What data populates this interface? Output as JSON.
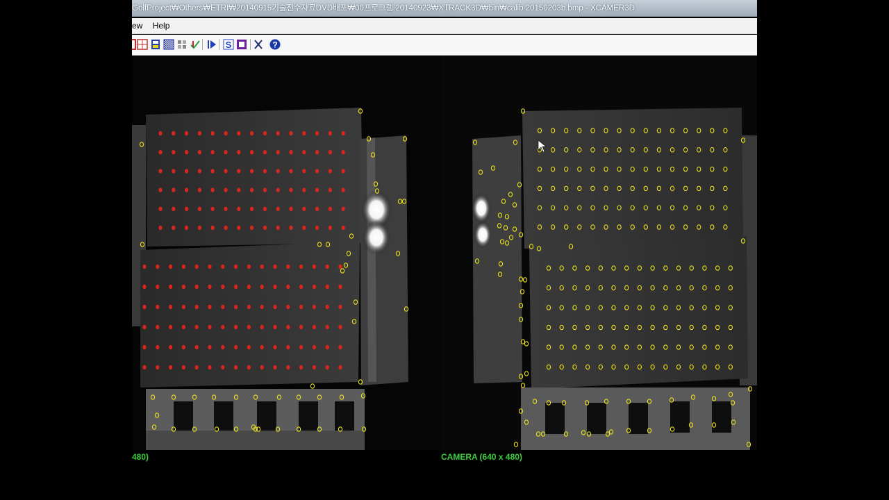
{
  "window": {
    "title": "GolfProject₩Others₩ETRI₩20140915기술전수자료DVD배포₩00프로그램 20140923₩XTRACK3D₩bin₩calib 20150203b.bmp - XCAMER3D"
  },
  "menu": {
    "items": [
      "ew",
      "Help"
    ]
  },
  "toolbar": {
    "buttons": [
      "grid-icon",
      "save-icon",
      "pattern-icon",
      "dots-icon",
      "check-icon",
      "play-icon",
      "s-icon",
      "stop-icon",
      "x-icon",
      "help-icon"
    ]
  },
  "status": {
    "left_camera_label": "480)",
    "right_camera_label": "CAMERA (640 x 480)"
  },
  "colors": {
    "detected_red": "#d8261e",
    "detected_yellow": "#e8e020",
    "label_green": "#3ccf3c"
  }
}
